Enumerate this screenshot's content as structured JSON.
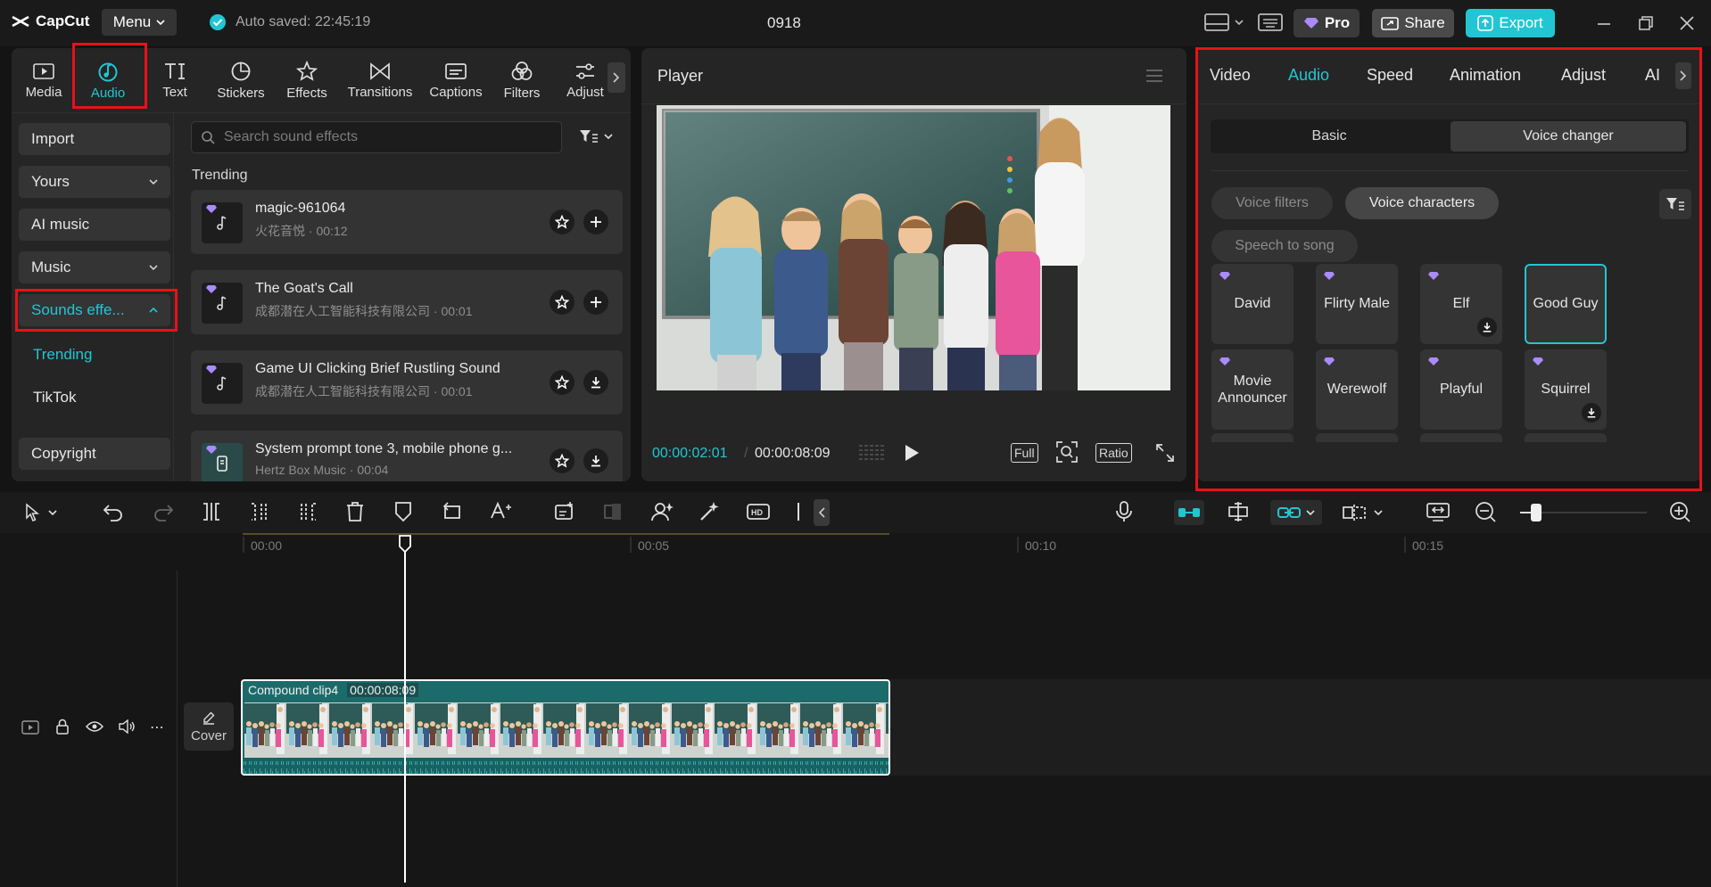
{
  "app": {
    "logo": "CapCut",
    "menu_label": "Menu",
    "autosave": "Auto saved: 22:45:19",
    "project_title": "0918"
  },
  "topbar": {
    "pro_label": "Pro",
    "share_label": "Share",
    "export_label": "Export"
  },
  "colors": {
    "accent": "#22c6d3",
    "highlight_red": "#e8111a",
    "pro_gem": "#a98bff"
  },
  "toolbar": {
    "items": [
      {
        "label": "Media",
        "icon": "media-icon"
      },
      {
        "label": "Audio",
        "icon": "audio-icon"
      },
      {
        "label": "Text",
        "icon": "text-icon"
      },
      {
        "label": "Stickers",
        "icon": "stickers-icon"
      },
      {
        "label": "Effects",
        "icon": "effects-icon"
      },
      {
        "label": "Transitions",
        "icon": "transitions-icon"
      },
      {
        "label": "Captions",
        "icon": "captions-icon"
      },
      {
        "label": "Filters",
        "icon": "filters-icon"
      },
      {
        "label": "Adjust",
        "icon": "adjust-icon"
      }
    ]
  },
  "audio_nav": {
    "import": "Import",
    "yours": "Yours",
    "ai_music": "AI music",
    "music": "Music",
    "sounds": "Sounds effe...",
    "trending": "Trending",
    "tiktok": "TikTok",
    "copyright": "Copyright"
  },
  "sfx": {
    "search_placeholder": "Search sound effects",
    "section": "Trending",
    "items": [
      {
        "title": "magic-961064",
        "sub": "火花音悦 · 00:12"
      },
      {
        "title": "The Goat's Call",
        "sub": "成都潜在人工智能科技有限公司 · 00:01"
      },
      {
        "title": "Game UI Clicking Brief Rustling Sound",
        "sub": "成都潜在人工智能科技有限公司 · 00:01"
      },
      {
        "title": "System prompt tone 3, mobile phone g...",
        "sub": "Hertz Box Music · 00:04"
      }
    ]
  },
  "player": {
    "title": "Player",
    "current_time": "00:00:02:01",
    "total_time": "00:00:08:09",
    "full_label": "Full",
    "ratio_label": "Ratio"
  },
  "right_panel": {
    "tabs": [
      "Video",
      "Audio",
      "Speed",
      "Animation",
      "Adjust",
      "AI"
    ],
    "subtabs": [
      "Basic",
      "Voice changer"
    ],
    "filters": [
      "Voice filters",
      "Voice characters",
      "Speech to song"
    ],
    "voices": [
      "David",
      "Flirty Male",
      "Elf",
      "Good Guy",
      "Movie Announcer",
      "Werewolf",
      "Playful",
      "Squirrel"
    ]
  },
  "timeline": {
    "ruler": [
      "00:00",
      "00:05",
      "00:10",
      "00:15"
    ],
    "clip_name": "Compound clip4",
    "clip_duration": "00:00:08:09",
    "cover_label": "Cover"
  }
}
